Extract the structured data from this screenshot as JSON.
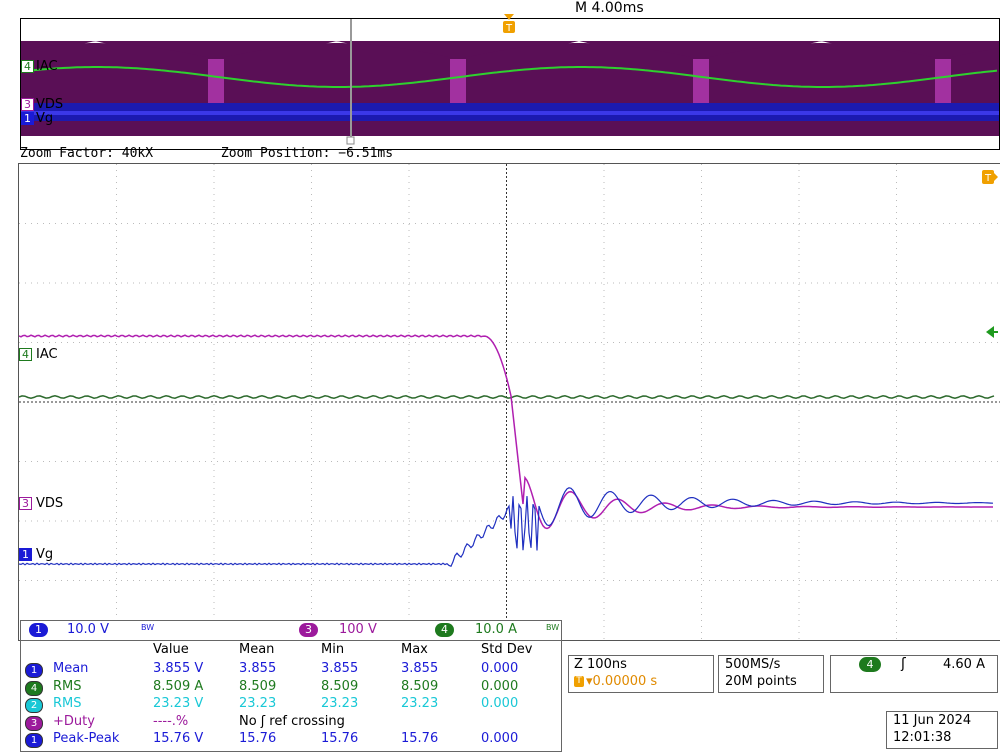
{
  "header": {
    "timebase": "M 4.00ms",
    "trigger_marker": "T"
  },
  "overview": {
    "labels": {
      "ch4": "IAC",
      "ch3": "VDS",
      "ch1": "Vg"
    },
    "ch_numbers": {
      "ch4": "4",
      "ch3": "3",
      "ch1": "1"
    }
  },
  "zoom": {
    "factor": "Zoom Factor: 40kX",
    "position": "Zoom Position: −6.51ms"
  },
  "main": {
    "labels": {
      "ch4": "IAC",
      "ch3": "VDS",
      "ch1": "Vg"
    },
    "ch_numbers": {
      "ch4": "4",
      "ch3": "3",
      "ch1": "1"
    },
    "trigger_marker": "T"
  },
  "scales": {
    "ch1": {
      "num": "1",
      "value": "10.0 V",
      "bw": "BW"
    },
    "ch3": {
      "num": "3",
      "value": "100 V"
    },
    "ch4": {
      "num": "4",
      "value": "10.0 A",
      "bw": "BW"
    }
  },
  "measurements": {
    "headers": [
      "Value",
      "Mean",
      "Min",
      "Max",
      "Std Dev"
    ],
    "rows": [
      {
        "ch": "1",
        "name": "Mean",
        "value": "3.855 V",
        "mean": "3.855",
        "min": "3.855",
        "max": "3.855",
        "std": "0.000",
        "color": "#1a1ad6"
      },
      {
        "ch": "4",
        "name": "RMS",
        "value": "8.509 A",
        "mean": "8.509",
        "min": "8.509",
        "max": "8.509",
        "std": "0.000",
        "color": "#1e7a1e"
      },
      {
        "ch": "2",
        "name": "RMS",
        "value": "23.23 V",
        "mean": "23.23",
        "min": "23.23",
        "max": "23.23",
        "std": "0.000",
        "color": "#19c8d6"
      },
      {
        "ch": "3",
        "name": "+Duty",
        "value": "----.%",
        "mean": "No ʃ ref crossing",
        "min": "",
        "max": "",
        "std": "",
        "color": "#9c1a9c"
      },
      {
        "ch": "1",
        "name": "Peak-Peak",
        "value": "15.76 V",
        "mean": "15.76",
        "min": "15.76",
        "max": "15.76",
        "std": "0.000",
        "color": "#1a1ad6"
      }
    ]
  },
  "zoom_box": {
    "line1": "Z 100ns",
    "line2": "▾0.00000 s"
  },
  "sample_box": {
    "line1": "500MS/s",
    "line2": "20M points"
  },
  "trigger_box": {
    "ch": "4",
    "slope": "ʃ",
    "level": "4.60 A"
  },
  "datetime": {
    "date": "11 Jun  2024",
    "time": "12:01:38"
  },
  "colors": {
    "ch1": "#1a1ad6",
    "ch2": "#19c8d6",
    "ch3": "#9c1a9c",
    "ch4": "#1e7a1e",
    "trigger": "#f0a000"
  }
}
